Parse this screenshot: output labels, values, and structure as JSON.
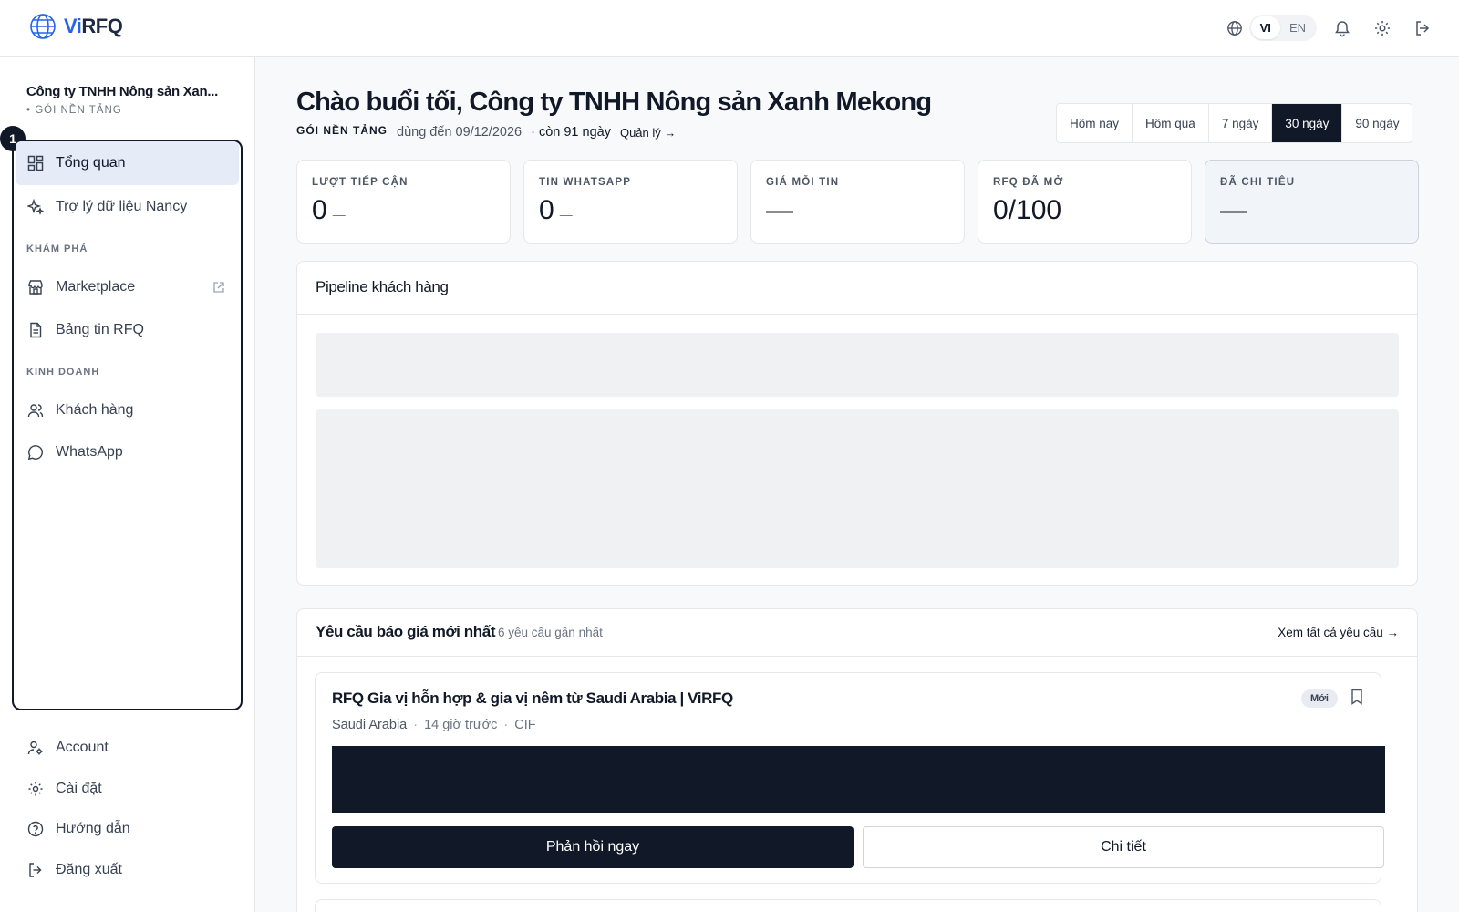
{
  "app": {
    "logo_prefix": "Vi",
    "logo_suffix": "RFQ"
  },
  "topbar": {
    "lang_vi": "VI",
    "lang_en": "EN"
  },
  "sidebar": {
    "company_name": "Công ty TNHH Nông sản Xan...",
    "company_plan": "• GÓI NỀN TẢNG",
    "step_badge": "1",
    "items": {
      "overview": "Tổng quan",
      "assistant": "Trợ lý dữ liệu Nancy",
      "section_explore": "KHÁM PHÁ",
      "marketplace": "Marketplace",
      "rfq_board": "Bảng tin RFQ",
      "section_business": "KINH DOANH",
      "customers": "Khách hàng",
      "whatsapp": "WhatsApp",
      "account": "Account",
      "settings": "Cài đặt",
      "help": "Hướng dẫn",
      "logout": "Đăng xuất"
    }
  },
  "header": {
    "greeting": "Chào buổi tối, Công ty TNHH Nông sản Xanh Mekong",
    "plan_tag": "GÓI NỀN TẢNG",
    "valid_until": "dùng đến 09/12/2026",
    "days_left": "· còn 91 ngày",
    "manage": "Quản lý →"
  },
  "ranges": [
    "Hôm nay",
    "Hôm qua",
    "7 ngày",
    "30 ngày",
    "90 ngày"
  ],
  "active_range": "30 ngày",
  "kpis": [
    {
      "label": "LƯỢT TIẾP CẬN",
      "value": "0",
      "trend": "—"
    },
    {
      "label": "TIN WHATSAPP",
      "value": "0",
      "trend": "—"
    },
    {
      "label": "GIÁ MỖI TIN",
      "value": "—",
      "trend": ""
    },
    {
      "label": "RFQ ĐÃ MỞ",
      "value": "0/100",
      "trend": ""
    },
    {
      "label": "ĐÃ CHI TIÊU",
      "value": "—",
      "trend": ""
    }
  ],
  "pipeline": {
    "title": "Pipeline khách hàng"
  },
  "rfq_section": {
    "title": "Yêu cầu báo giá mới nhất",
    "subtitle": "6 yêu cầu gần nhất",
    "view_all": "Xem tất cả yêu cầu →",
    "item": {
      "title": "RFQ Gia vị hỗn hợp & gia vị nêm từ Saudi Arabia | ViRFQ",
      "country": "Saudi Arabia",
      "time": "14 giờ trước",
      "incoterm": "CIF",
      "sep": "·",
      "tag": "Mới",
      "reply": "Phản hồi ngay",
      "detail": "Chi tiết"
    }
  },
  "colors": {
    "accent": "#2563eb",
    "dark": "#111827",
    "active_nav": "#e5ecf7"
  }
}
